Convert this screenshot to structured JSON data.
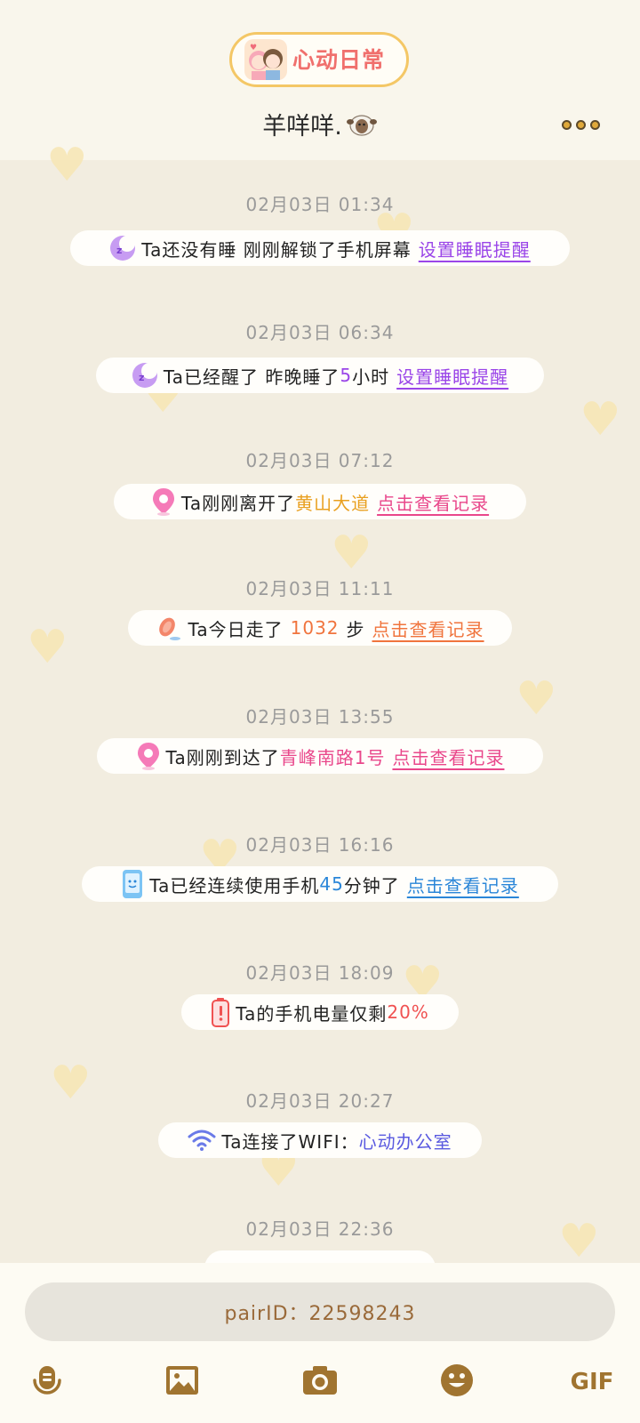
{
  "header": {
    "brand": "心动日常",
    "nickname": "羊咩咩."
  },
  "events": [
    {
      "time": "02月03日 01:34",
      "text": "Ta还没有睡 刚刚解锁了手机屏幕",
      "link": "设置睡眠提醒"
    },
    {
      "time": "02月03日 06:34",
      "pre": "Ta已经醒了 昨晚睡了",
      "hours": "5",
      "post": "小时",
      "link": "设置睡眠提醒"
    },
    {
      "time": "02月03日 07:12",
      "pre": "Ta刚刚离开了",
      "place": "黄山大道",
      "link": "点击查看记录"
    },
    {
      "time": "02月03日 11:11",
      "pre": "Ta今日走了",
      "steps": "1032",
      "post": "步",
      "link": "点击查看记录"
    },
    {
      "time": "02月03日 13:55",
      "pre": "Ta刚刚到达了",
      "place": "青峰南路1号",
      "link": "点击查看记录"
    },
    {
      "time": "02月03日 16:16",
      "pre": "Ta已经连续使用手机",
      "minutes": "45",
      "post": "分钟了",
      "link": "点击查看记录"
    },
    {
      "time": "02月03日 18:09",
      "pre": "Ta的手机电量仅剩",
      "battery": "20%"
    },
    {
      "time": "02月03日 20:27",
      "pre": "Ta连接了WIFI：",
      "wifi": "心动办公室"
    },
    {
      "time": "02月03日 22:36"
    }
  ],
  "bottom": {
    "pair_id": "pairID：22598243",
    "toolbar": [
      "voice-icon",
      "image-icon",
      "camera-icon",
      "emoji-icon",
      "GIF"
    ],
    "gif_label": "GIF"
  },
  "colors": {
    "background": "#f2ede0",
    "sleep_link": "#9a45e8",
    "location_link": "#e9478b",
    "steps_link": "#f0743d",
    "usage_link": "#2a86d8",
    "battery": "#f05252",
    "wifi": "#5a5ae0"
  }
}
